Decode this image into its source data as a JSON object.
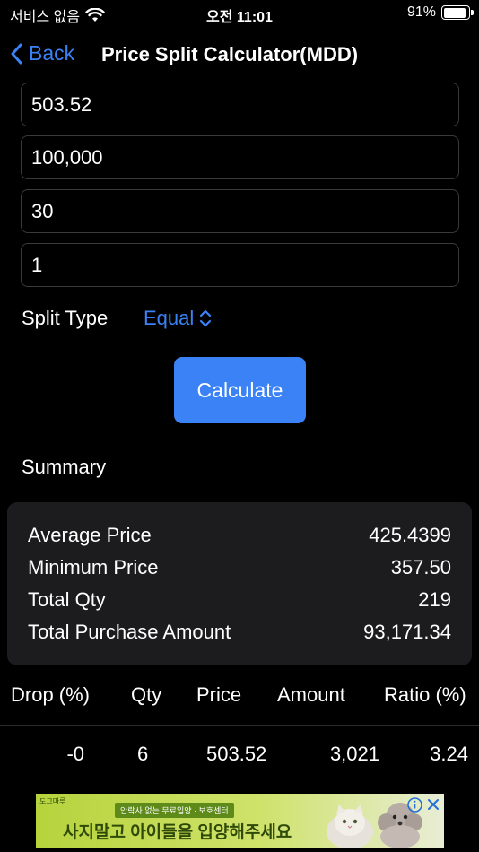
{
  "status": {
    "carrier": "서비스 없음",
    "time": "오전 11:01",
    "battery": "91%",
    "battery_level": 0.91
  },
  "nav": {
    "back_label": "Back",
    "title": "Price Split Calculator(MDD)"
  },
  "inputs": [
    "503.52",
    "100,000",
    "30",
    "1"
  ],
  "split": {
    "label": "Split Type",
    "value": "Equal"
  },
  "calculate_label": "Calculate",
  "summary": {
    "heading": "Summary",
    "rows": [
      {
        "label": "Average Price",
        "value": "425.4399"
      },
      {
        "label": "Minimum Price",
        "value": "357.50"
      },
      {
        "label": "Total Qty",
        "value": "219"
      },
      {
        "label": "Total Purchase Amount",
        "value": "93,171.34"
      }
    ]
  },
  "table": {
    "headers": [
      "Drop (%)",
      "Qty",
      "Price",
      "Amount",
      "Ratio (%)"
    ],
    "rows": [
      [
        "-0",
        "6",
        "503.52",
        "3,021",
        "3.24"
      ]
    ]
  },
  "ad": {
    "brand": "도그마루",
    "small_text": "안락사 없는 무료입양 · 보호센터",
    "main_text": "사지말고 아이들을 입양해주세요"
  }
}
